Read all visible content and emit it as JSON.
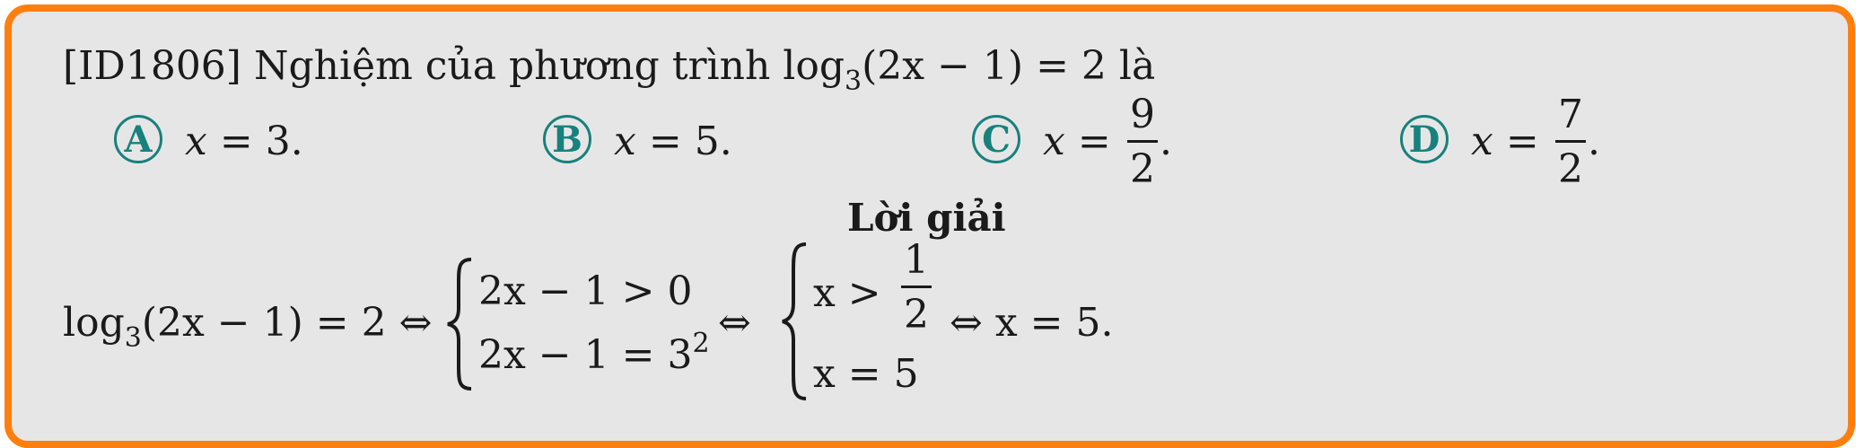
{
  "question": {
    "id": "[ID1806]",
    "prefix": "Nghiệm của phương trình",
    "log_text": "log",
    "log_base": "3",
    "argument": "(2x − 1) = 2",
    "suffix": "là"
  },
  "options": [
    {
      "letter": "A",
      "lhs": "x",
      "eq": "=",
      "value": "3."
    },
    {
      "letter": "B",
      "lhs": "x",
      "eq": "=",
      "value": "5."
    },
    {
      "letter": "C",
      "lhs": "x",
      "eq": "=",
      "num": "9",
      "den": "2",
      "tail": "."
    },
    {
      "letter": "D",
      "lhs": "x",
      "eq": "=",
      "num": "7",
      "den": "2",
      "tail": "."
    }
  ],
  "solution": {
    "title": "Lời giải",
    "log_text": "log",
    "log_base": "3",
    "lhs_rest": "(2x − 1) = 2 ⇔",
    "system1": [
      "2x − 1 > 0",
      "2x − 1 = 3"
    ],
    "system1_exp": "2",
    "equiv": "⇔",
    "system2_line1_left": "x >",
    "system2_num": "1",
    "system2_den": "2",
    "system2_line2": "x = 5",
    "conclusion": "⇔ x = 5."
  },
  "colors": {
    "border": "#ff7f0e",
    "background": "#e6e6e6",
    "option_circle": "#17817d"
  }
}
